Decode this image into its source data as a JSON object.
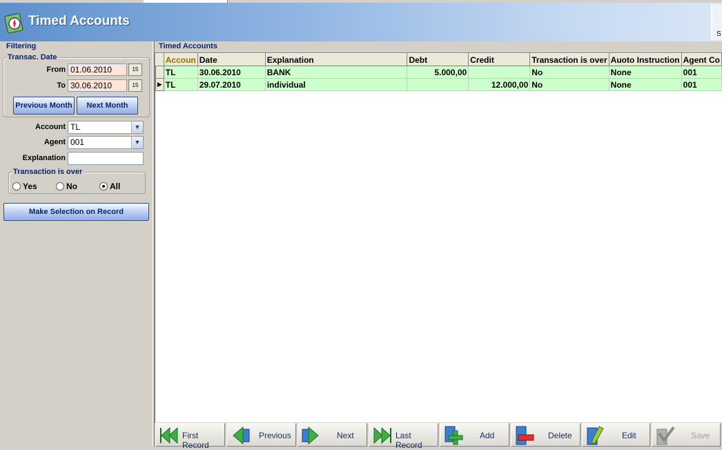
{
  "header": {
    "title": "Timed Accounts",
    "right_stub": "S"
  },
  "filter": {
    "section_title": "Filtering",
    "date_group_title": "Transac. Date",
    "from_label": "From",
    "from_value": "01.06.2010",
    "to_label": "To",
    "to_value": "30.06.2010",
    "prev_month_label": "Previous Month",
    "next_month_label": "Next Month",
    "account_label": "Account",
    "account_value": "TL",
    "agent_label": "Agent",
    "agent_value": "001",
    "explanation_label": "Explanation",
    "explanation_value": "",
    "over_group_title": "Transaction is over",
    "radio_yes": "Yes",
    "radio_no": "No",
    "radio_all": "All",
    "radio_selected": "All",
    "make_selection_label": "Make Selection on Record"
  },
  "grid": {
    "title": "Timed Accounts",
    "columns": [
      "Accoun",
      "Date",
      "Explanation",
      "Debt",
      "Credit",
      "Transaction is over",
      "Auoto Instruction",
      "Agent Co"
    ],
    "rows": [
      [
        "TL",
        "30.06.2010",
        "BANK",
        "5.000,00",
        "",
        "No",
        "None",
        "001"
      ],
      [
        "TL",
        "29.07.2010",
        "individual",
        "",
        "12.000,00",
        "No",
        "None",
        "001"
      ]
    ],
    "current_row": 1
  },
  "nav": {
    "first": "First Record",
    "previous": "Previous",
    "next": "Next",
    "last": "Last Record",
    "add": "Add",
    "delete": "Delete",
    "edit": "Edit",
    "save": "Save"
  },
  "colors": {
    "row_bg": "#ccffcc",
    "date_bg": "#fde6d9",
    "header_blue": "#5e90cc",
    "label_blue": "#0a246a"
  }
}
